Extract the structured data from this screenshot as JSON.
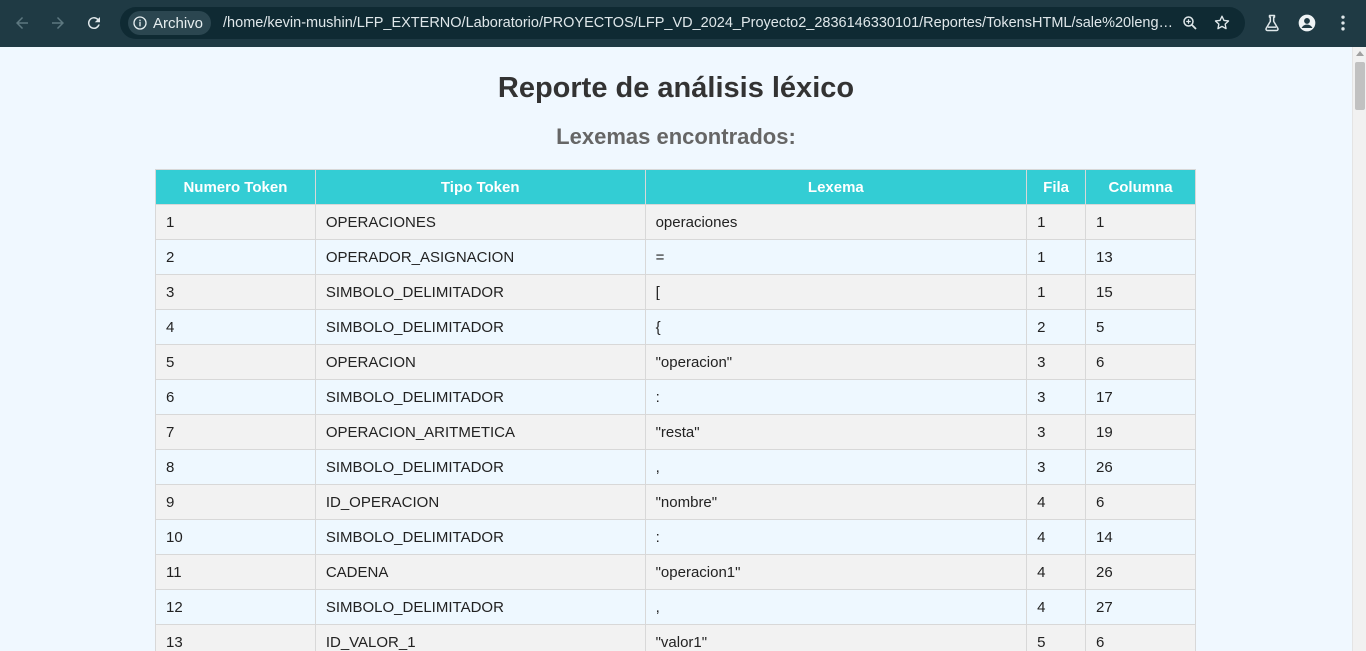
{
  "browser": {
    "security_chip": "Archivo",
    "url": "/home/kevin-mushin/LFP_EXTERNO/Laboratorio/PROYECTOS/LFP_VD_2024_Proyecto2_2836146330101/Reportes/TokensHTML/sale%20lenguajes.h...",
    "icons": [
      "back-icon",
      "forward-icon",
      "reload-icon",
      "info-icon",
      "zoom-icon",
      "star-icon",
      "labs-icon",
      "profile-icon",
      "menu-icon"
    ]
  },
  "page": {
    "title": "Reporte de análisis léxico",
    "subtitle": "Lexemas encontrados:",
    "header_color": "#33cdd4"
  },
  "table": {
    "headers": [
      "Numero Token",
      "Tipo Token",
      "Lexema",
      "Fila",
      "Columna"
    ],
    "rows": [
      [
        "1",
        "OPERACIONES",
        "operaciones",
        "1",
        "1"
      ],
      [
        "2",
        "OPERADOR_ASIGNACION",
        "=",
        "1",
        "13"
      ],
      [
        "3",
        "SIMBOLO_DELIMITADOR",
        "[",
        "1",
        "15"
      ],
      [
        "4",
        "SIMBOLO_DELIMITADOR",
        "{",
        "2",
        "5"
      ],
      [
        "5",
        "OPERACION",
        "\"operacion\"",
        "3",
        "6"
      ],
      [
        "6",
        "SIMBOLO_DELIMITADOR",
        ":",
        "3",
        "17"
      ],
      [
        "7",
        "OPERACION_ARITMETICA",
        "\"resta\"",
        "3",
        "19"
      ],
      [
        "8",
        "SIMBOLO_DELIMITADOR",
        ",",
        "3",
        "26"
      ],
      [
        "9",
        "ID_OPERACION",
        "\"nombre\"",
        "4",
        "6"
      ],
      [
        "10",
        "SIMBOLO_DELIMITADOR",
        ":",
        "4",
        "14"
      ],
      [
        "11",
        "CADENA",
        "\"operacion1\"",
        "4",
        "26"
      ],
      [
        "12",
        "SIMBOLO_DELIMITADOR",
        ",",
        "4",
        "27"
      ],
      [
        "13",
        "ID_VALOR_1",
        "\"valor1\"",
        "5",
        "6"
      ]
    ]
  }
}
